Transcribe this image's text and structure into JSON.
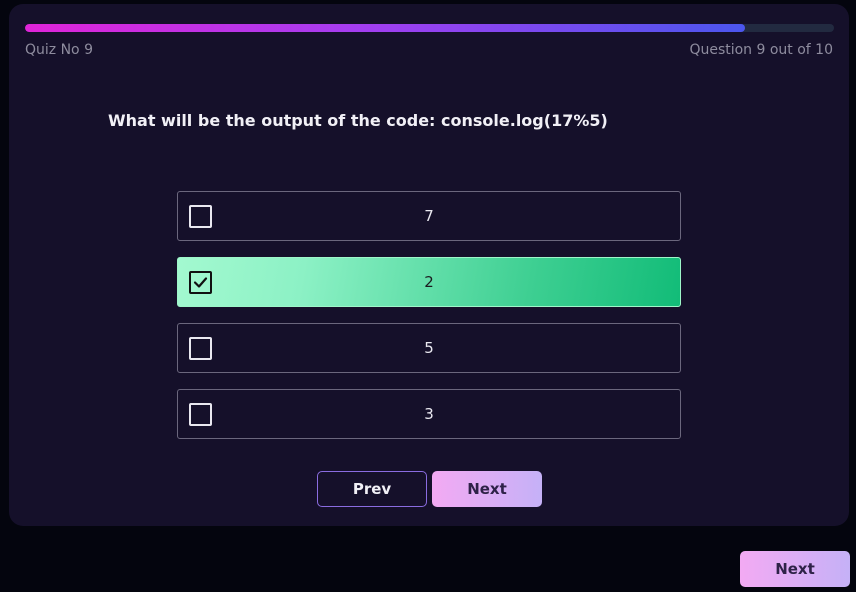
{
  "quiz": {
    "label": "Quiz No 9",
    "counter": "Question 9 out of 10",
    "progress_fraction": 0.89,
    "question": "What will be the output of the code: console.log(17%5)"
  },
  "options": [
    {
      "label": "7",
      "selected": false
    },
    {
      "label": "2",
      "selected": true
    },
    {
      "label": "5",
      "selected": false
    },
    {
      "label": "3",
      "selected": false
    }
  ],
  "nav": {
    "prev_label": "Prev",
    "next_label": "Next"
  },
  "footer": {
    "next_label": "Next"
  },
  "colors": {
    "card_background": "#15102a",
    "page_background": "#04050e",
    "selected_option": "#12bc78",
    "progress_start": "#e024d8",
    "progress_end": "#4b56ee"
  },
  "icons": {
    "checkbox": "checkbox-icon",
    "check": "check-icon"
  }
}
